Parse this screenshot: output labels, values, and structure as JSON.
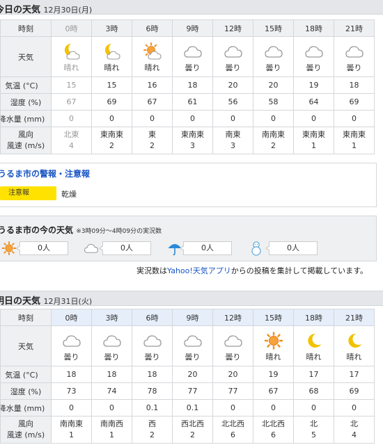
{
  "today": {
    "title": "今日の天気",
    "date": "12月30日(月)",
    "labels": {
      "time": "時刻",
      "weather": "天気",
      "temp": "気温 (°C)",
      "humidity": "湿度 (%)",
      "precip": "降水量 (mm)",
      "wind_dir": "風向",
      "wind_speed": "風速 (m/s)"
    },
    "hours": [
      {
        "time": "0時",
        "icon": "moon-cloud-icon",
        "weather": "晴れ",
        "temp": "15",
        "humidity": "67",
        "precip": "0",
        "wind_dir": "北東",
        "wind_speed": "4"
      },
      {
        "time": "3時",
        "icon": "moon-cloud-icon",
        "weather": "晴れ",
        "temp": "15",
        "humidity": "69",
        "precip": "0",
        "wind_dir": "東南東",
        "wind_speed": "2"
      },
      {
        "time": "6時",
        "icon": "sun-cloud-icon",
        "weather": "晴れ",
        "temp": "16",
        "humidity": "67",
        "precip": "0",
        "wind_dir": "東",
        "wind_speed": "2"
      },
      {
        "time": "9時",
        "icon": "cloud-icon",
        "weather": "曇り",
        "temp": "18",
        "humidity": "61",
        "precip": "0",
        "wind_dir": "東南東",
        "wind_speed": "3"
      },
      {
        "time": "12時",
        "icon": "cloud-icon",
        "weather": "曇り",
        "temp": "20",
        "humidity": "56",
        "precip": "0",
        "wind_dir": "南東",
        "wind_speed": "3"
      },
      {
        "time": "15時",
        "icon": "cloud-icon",
        "weather": "曇り",
        "temp": "20",
        "humidity": "58",
        "precip": "0",
        "wind_dir": "南南東",
        "wind_speed": "2"
      },
      {
        "time": "18時",
        "icon": "cloud-icon",
        "weather": "曇り",
        "temp": "19",
        "humidity": "64",
        "precip": "0",
        "wind_dir": "東南東",
        "wind_speed": "1"
      },
      {
        "time": "21時",
        "icon": "cloud-icon",
        "weather": "曇り",
        "temp": "18",
        "humidity": "69",
        "precip": "0",
        "wind_dir": "東南東",
        "wind_speed": "1"
      }
    ]
  },
  "warning": {
    "title": "うるま市の警報・注意報",
    "badge": "注意報",
    "text": "乾燥"
  },
  "now": {
    "title": "うるま市の今の天気",
    "subtitle": "※3時09分〜4時09分の実況数",
    "items": [
      {
        "icon": "sun-icon",
        "count": "0人"
      },
      {
        "icon": "cloud-icon",
        "count": "0人"
      },
      {
        "icon": "umbrella-icon",
        "count": "0人"
      },
      {
        "icon": "snowman-icon",
        "count": "0人"
      }
    ],
    "note_before": "実況数は",
    "note_link": "Yahoo!天気アプリ",
    "note_after": "からの投稿を集計して掲載しています。"
  },
  "tomorrow": {
    "title": "明日の天気",
    "date": "12月31日(火)",
    "labels": {
      "time": "時刻",
      "weather": "天気",
      "temp": "気温 (°C)",
      "humidity": "湿度 (%)",
      "precip": "降水量 (mm)",
      "wind_dir": "風向",
      "wind_speed": "風速 (m/s)"
    },
    "hours": [
      {
        "time": "0時",
        "icon": "cloud-icon",
        "weather": "曇り",
        "temp": "18",
        "humidity": "73",
        "precip": "0",
        "wind_dir": "南南東",
        "wind_speed": "1"
      },
      {
        "time": "3時",
        "icon": "cloud-icon",
        "weather": "曇り",
        "temp": "18",
        "humidity": "74",
        "precip": "0",
        "wind_dir": "南南西",
        "wind_speed": "1"
      },
      {
        "time": "6時",
        "icon": "cloud-icon",
        "weather": "曇り",
        "temp": "18",
        "humidity": "78",
        "precip": "0.1",
        "wind_dir": "西",
        "wind_speed": "2"
      },
      {
        "time": "9時",
        "icon": "cloud-icon",
        "weather": "曇り",
        "temp": "20",
        "humidity": "77",
        "precip": "0.1",
        "wind_dir": "西北西",
        "wind_speed": "2"
      },
      {
        "time": "12時",
        "icon": "cloud-icon",
        "weather": "曇り",
        "temp": "20",
        "humidity": "77",
        "precip": "0",
        "wind_dir": "北北西",
        "wind_speed": "6"
      },
      {
        "time": "15時",
        "icon": "sun-icon",
        "weather": "晴れ",
        "temp": "19",
        "humidity": "67",
        "precip": "0",
        "wind_dir": "北北西",
        "wind_speed": "6"
      },
      {
        "time": "18時",
        "icon": "moon-icon",
        "weather": "晴れ",
        "temp": "17",
        "humidity": "68",
        "precip": "0",
        "wind_dir": "北",
        "wind_speed": "5"
      },
      {
        "time": "21時",
        "icon": "moon-icon",
        "weather": "晴れ",
        "temp": "17",
        "humidity": "69",
        "precip": "0",
        "wind_dir": "北",
        "wind_speed": "4"
      }
    ]
  },
  "colors": {
    "accent": "#1a56c4",
    "warning": "#ffe200",
    "sun": "#f08c1a",
    "moon": "#f2c200",
    "cloud": "#9a9a9a"
  }
}
